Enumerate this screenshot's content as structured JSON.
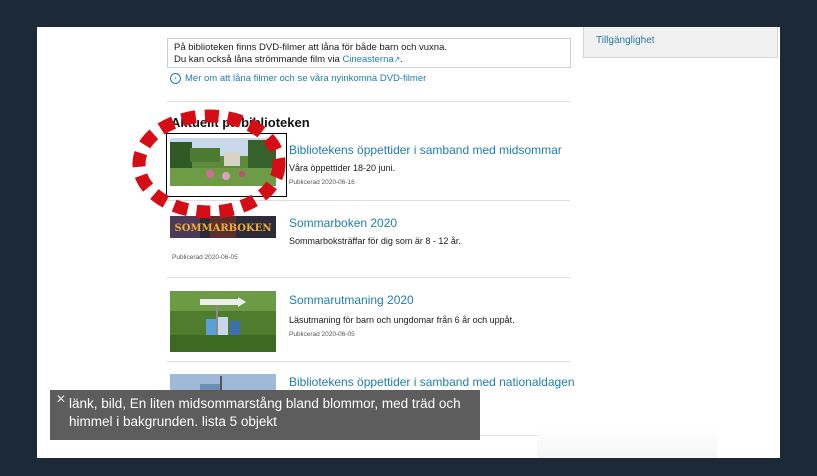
{
  "sidebar": {
    "accessibility_link": "Tillgänglighet"
  },
  "notice": {
    "line1": "På biblioteken finns DVD-filmer att låna för både barn och vuxna.",
    "line2_prefix": "Du kan också låna strömmande film via ",
    "line2_link": "Cineasterna",
    "external_icon": "external-link-icon"
  },
  "more_link": {
    "icon": "arrow-circle-icon",
    "label": "Mer om att låna filmer och se våra nyinkomna DVD-filmer"
  },
  "news_section": {
    "title": "Aktuellt på biblioteken",
    "items": [
      {
        "title": "Bibliotekens öppettider i samband med midsommar",
        "desc": "Våra öppettider 18-20 juni.",
        "date": "Publicerad 2020-06-16"
      },
      {
        "title": "Sommarboken 2020",
        "desc": "Sommarboksträffar för dig som är 8 - 12 år.",
        "date": "Publicerad 2020-06-05",
        "image_text": "SOMMARBOKEN"
      },
      {
        "title": "Sommarutmaning 2020",
        "desc": "Läsutmaning för barn och ungdomar från 6 år och uppåt.",
        "date": "Publicerad 2020-06-05"
      },
      {
        "title": "Bibliotekens öppettider i samband med nationaldagen"
      }
    ]
  },
  "screen_reader": {
    "close_icon": "close-icon",
    "caption": "länk, bild, En liten midsommarstång bland blommor, med träd och himmel i bakgrunden. lista  5 objekt"
  },
  "colors": {
    "link": "#1f7dae",
    "frame": "#1c2a38",
    "marker": "#d40d16",
    "caption_bg": "#5d5d5d"
  }
}
